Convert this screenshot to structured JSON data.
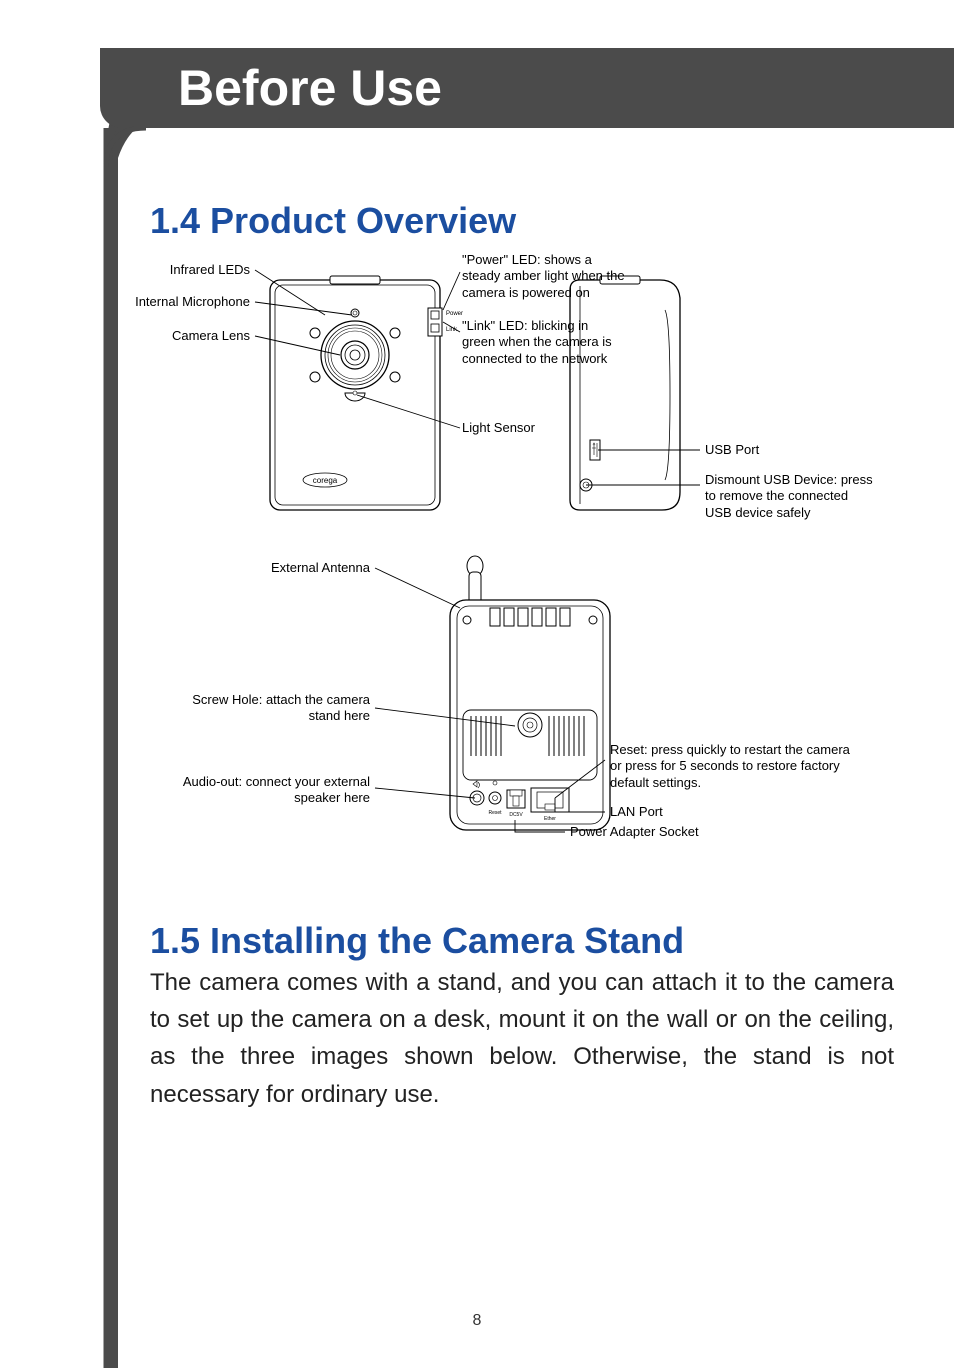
{
  "header": {
    "title": "Before Use"
  },
  "section14": {
    "heading": "1.4 Product Overview"
  },
  "diagram": {
    "brand": "corega",
    "labels": {
      "infrared_leds": "Infrared LEDs",
      "internal_microphone": "Internal Microphone",
      "camera_lens": "Camera Lens",
      "power_led": "\"Power\" LED: shows a steady amber light when the camera is powered on",
      "link_led": "\"Link\" LED: blicking in green when the camera is connected to the network",
      "light_sensor": "Light Sensor",
      "usb_port": "USB Port",
      "dismount_usb": "Dismount USB Device: press to remove the connected USB device safely",
      "external_antenna": "External Antenna",
      "screw_hole": "Screw Hole: attach the camera stand here",
      "audio_out": "Audio-out: connect your external speaker here",
      "reset": "Reset: press quickly to restart the camera or press for 5 seconds to restore factory default settings.",
      "lan_port": "LAN Port",
      "power_adapter_socket": "Power Adapter Socket",
      "tiny_power": "Power",
      "tiny_link": "Link",
      "tiny_reset": "Reset",
      "tiny_dc5v": "DC5V",
      "tiny_ether": "Ether"
    }
  },
  "section15": {
    "heading": "1.5 Installing the Camera Stand",
    "body": "The camera comes with a stand, and you can attach it to the camera to set up the camera on a desk, mount it on the wall or on the ceiling, as the three images shown below. Otherwise, the stand is not necessary for ordinary use."
  },
  "page_number": "8"
}
